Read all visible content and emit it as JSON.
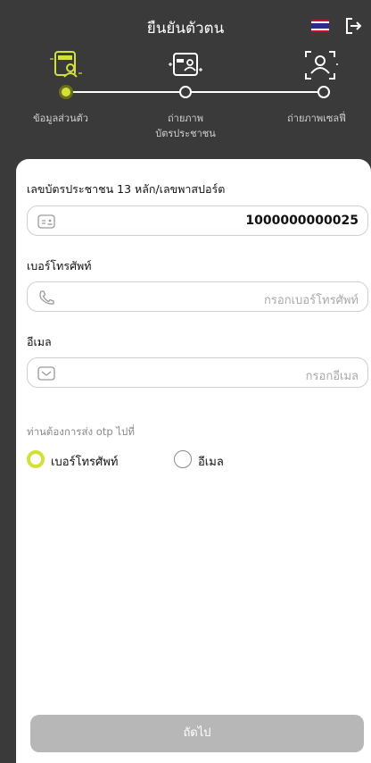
{
  "header": {
    "title": "ยืนยันตัวตน",
    "language_icon": "thai-flag-icon",
    "logout_icon": "logout-icon"
  },
  "steps": [
    {
      "label": "ข้อมูลส่วนตัว",
      "icon": "person-card-icon",
      "active": true
    },
    {
      "label_line1": "ถ่ายภาพ",
      "label_line2": "บัตรประชาชน",
      "icon": "id-card-icon",
      "active": false
    },
    {
      "label": "ถ่ายภาพเซลฟี่",
      "icon": "selfie-scan-icon",
      "active": false
    }
  ],
  "form": {
    "id_label": "เลขบัตรประชาชน 13 หลัก/เลขพาสปอร์ต",
    "id_value": "1000000000025",
    "phone_label": "เบอร์โทรศัพท์",
    "phone_placeholder": "กรอกเบอร์โทรศัพท์",
    "email_label": "อีเมล",
    "email_placeholder": "กรอกอีเมล",
    "otp_question": "ท่านต้องการส่ง otp ไปที่",
    "otp_options": [
      {
        "label": "เบอร์โทรศัพท์",
        "selected": true
      },
      {
        "label": "อีเมล",
        "selected": false
      }
    ]
  },
  "next_button": "ถัดไป",
  "colors": {
    "accent": "#d4e03a",
    "header_bg": "#3a3a3a",
    "button_disabled": "#b7b7b7"
  }
}
